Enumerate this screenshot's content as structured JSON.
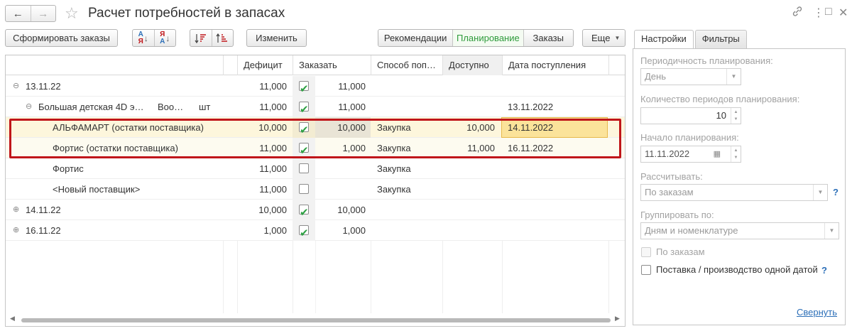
{
  "window": {
    "title": "Расчет потребностей в запасах",
    "back_icon": "←",
    "forward_icon": "→",
    "star_icon": "☆",
    "link_icon": "🔗",
    "more_icon": "⋮",
    "maximize_icon": "□",
    "close_icon": "✕"
  },
  "toolbar": {
    "generate_orders": "Сформировать заказы",
    "sort_asc_top": "А",
    "sort_asc_bottom": "Я",
    "sort_desc_top": "Я",
    "sort_desc_bottom": "А",
    "edit": "Изменить",
    "more": "Еще",
    "views": [
      "Рекомендации",
      "Планирование",
      "Заказы"
    ],
    "active_view": "Планирование"
  },
  "table": {
    "columns": [
      "",
      "Дефицит",
      "Заказать",
      "",
      "Способ поп…",
      "Доступно",
      "Дата поступления"
    ],
    "rows": [
      {
        "label": "13.11.22",
        "level": 0,
        "expander": "⊖",
        "deficit": "11,000",
        "checked": true,
        "order": "11,000",
        "method": "",
        "available": "",
        "date": ""
      },
      {
        "label": "Большая детская 4D э…",
        "extra": "Воо…",
        "unit": "шт",
        "level": 1,
        "expander": "⊖",
        "deficit": "11,000",
        "checked": true,
        "order": "11,000",
        "method": "",
        "available": "",
        "date": "13.11.2022"
      },
      {
        "label": "АЛЬФАМАРТ (остатки поставщика)",
        "level": 2,
        "deficit": "10,000",
        "checked": true,
        "order": "10,000",
        "method": "Закупка",
        "available": "10,000",
        "date": "14.11.2022",
        "selected": true
      },
      {
        "label": "Фортис (остатки поставщика)",
        "level": 2,
        "deficit": "11,000",
        "checked": true,
        "order": "1,000",
        "method": "Закупка",
        "available": "11,000",
        "date": "16.11.2022"
      },
      {
        "label": "Фортис",
        "level": 2,
        "deficit": "11,000",
        "checked": false,
        "order": "",
        "method": "Закупка",
        "available": "",
        "date": ""
      },
      {
        "label": "<Новый поставщик>",
        "level": 2,
        "deficit": "11,000",
        "checked": false,
        "order": "",
        "method": "Закупка",
        "available": "",
        "date": ""
      },
      {
        "label": "14.11.22",
        "level": 0,
        "expander": "⊕",
        "deficit": "10,000",
        "checked": true,
        "order": "10,000",
        "method": "",
        "available": "",
        "date": ""
      },
      {
        "label": "16.11.22",
        "level": 0,
        "expander": "⊕",
        "deficit": "1,000",
        "checked": true,
        "order": "1,000",
        "method": "",
        "available": "",
        "date": ""
      }
    ]
  },
  "settings": {
    "tabs": [
      "Настройки",
      "Фильтры"
    ],
    "active_tab": "Настройки",
    "periodicity_label": "Периодичность планирования:",
    "periodicity_value": "День",
    "periods_count_label": "Количество периодов планирования:",
    "periods_count_value": "10",
    "start_label": "Начало планирования:",
    "start_value": "11.11.2022",
    "calculate_label": "Рассчитывать:",
    "calculate_value": "По заказам",
    "group_label": "Группировать по:",
    "group_value": "Дням и номенклатуре",
    "by_orders_label": "По заказам",
    "single_date_label": "Поставка / производство одной датой",
    "help_icon": "?",
    "collapse_link": "Свернуть"
  },
  "colors": {
    "active_view": "#2e9b3b",
    "selection_row": "#fdf6dc",
    "current_cell": "#fbe39a",
    "highlight_box": "#c0161a",
    "link": "#2c6fb8"
  }
}
